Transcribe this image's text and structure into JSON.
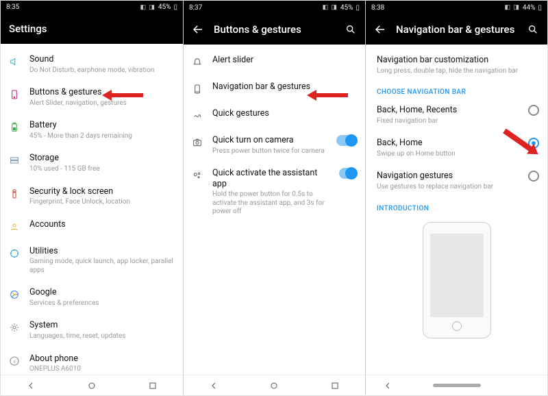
{
  "panel1": {
    "status": {
      "time": "8:35",
      "battery": "45%"
    },
    "header": {
      "title": "Settings"
    },
    "rows": [
      {
        "icon": "sound-icon",
        "label": "Sound",
        "sub": "Do Not Disturb, earphone mode, vibration"
      },
      {
        "icon": "buttons-icon",
        "label": "Buttons & gestures",
        "sub": "Alert Slider, navigation, gestures"
      },
      {
        "icon": "battery-icon",
        "label": "Battery",
        "sub": "45% - More than 2 days remaining"
      },
      {
        "icon": "storage-icon",
        "label": "Storage",
        "sub": "10% used - 115 GB free"
      },
      {
        "icon": "security-icon",
        "label": "Security & lock screen",
        "sub": "Fingerprint, Face Unlock, location"
      },
      {
        "icon": "accounts-icon",
        "label": "Accounts",
        "sub": ""
      },
      {
        "icon": "utilities-icon",
        "label": "Utilities",
        "sub": "Gaming mode, quick launch, app locker, parallel apps"
      },
      {
        "icon": "google-icon",
        "label": "Google",
        "sub": "Services & preferences"
      },
      {
        "icon": "system-icon",
        "label": "System",
        "sub": "Languages, time, reset, updates"
      },
      {
        "icon": "about-icon",
        "label": "About phone",
        "sub": "ONEPLUS A6010"
      }
    ]
  },
  "panel2": {
    "status": {
      "time": "8:37",
      "battery": "45%"
    },
    "header": {
      "title": "Buttons & gestures"
    },
    "rows": [
      {
        "icon": "alert-slider-icon",
        "label": "Alert slider",
        "sub": ""
      },
      {
        "icon": "navbar-icon",
        "label": "Navigation bar & gestures",
        "sub": ""
      },
      {
        "icon": "gesture-icon",
        "label": "Quick gestures",
        "sub": ""
      },
      {
        "icon": "camera-icon",
        "label": "Quick turn on camera",
        "sub": "Press power button twice for camera",
        "toggle": true
      },
      {
        "icon": "assistant-icon",
        "label": "Quick activate the assistant app",
        "sub": "Hold the power button for 0.5s to activate the assistant app, and 3s for power off",
        "toggle": true
      }
    ]
  },
  "panel3": {
    "status": {
      "time": "8:38",
      "battery": "44%"
    },
    "header": {
      "title": "Navigation bar & gestures"
    },
    "top": {
      "label": "Navigation bar customization",
      "sub": "Long press, double tap, hide the navigation bar"
    },
    "section_choose": "CHOOSE NAVIGATION BAR",
    "options": [
      {
        "label": "Back, Home, Recents",
        "sub": "Fixed navigation bar",
        "selected": false
      },
      {
        "label": "Back, Home",
        "sub": "Swipe up on Home button",
        "selected": true
      },
      {
        "label": "Navigation gestures",
        "sub": "Use gestures to replace navigation bar",
        "selected": false
      }
    ],
    "section_intro": "INTRODUCTION"
  }
}
